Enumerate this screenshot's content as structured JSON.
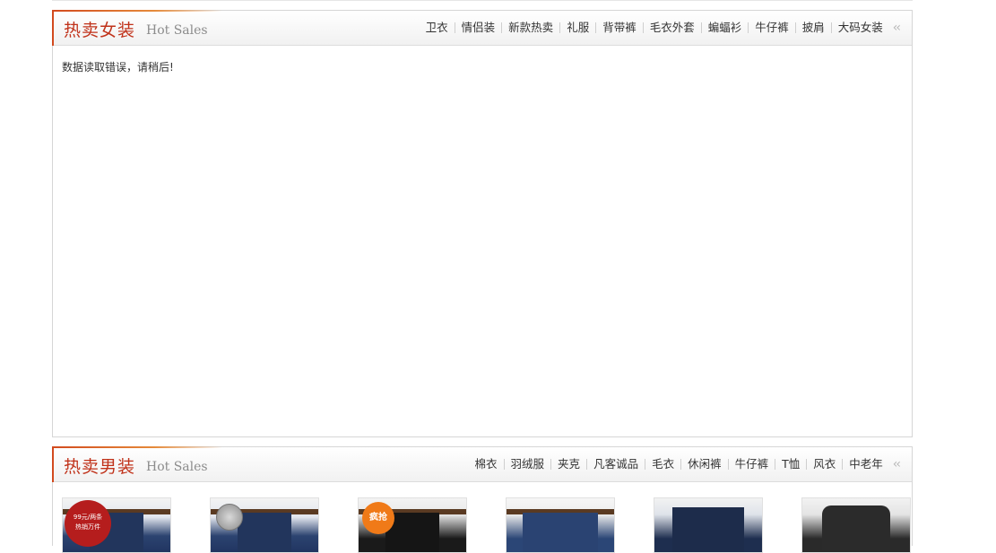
{
  "women": {
    "title_cn": "热卖女装",
    "title_en": "Hot Sales",
    "tabs": [
      "卫衣",
      "情侣装",
      "新款热卖",
      "礼服",
      "背带裤",
      "毛衣外套",
      "蝙蝠衫",
      "牛仔裤",
      "披肩",
      "大码女装"
    ],
    "message": "数据读取错误，请稍后!"
  },
  "men": {
    "title_cn": "热卖男装",
    "title_en": "Hot Sales",
    "tabs": [
      "棉衣",
      "羽绒服",
      "夹克",
      "凡客诚品",
      "毛衣",
      "休闲裤",
      "牛仔裤",
      "T恤",
      "风衣",
      "中老年"
    ],
    "products": [
      {
        "badge_line1": "99元/两条",
        "badge_line2": "热销万件"
      },
      {
        "badge_line1": "",
        "badge_line2": ""
      },
      {
        "badge_line1": "疯抢",
        "badge_line2": ""
      },
      {
        "badge_line1": "",
        "badge_line2": ""
      },
      {
        "badge_line1": "",
        "badge_line2": ""
      },
      {
        "badge_line1": "",
        "badge_line2": ""
      }
    ]
  },
  "icons": {
    "more": "double-chevron-left-icon"
  },
  "colors": {
    "title_red": "#c0321a",
    "accent": "#d24a1e"
  }
}
